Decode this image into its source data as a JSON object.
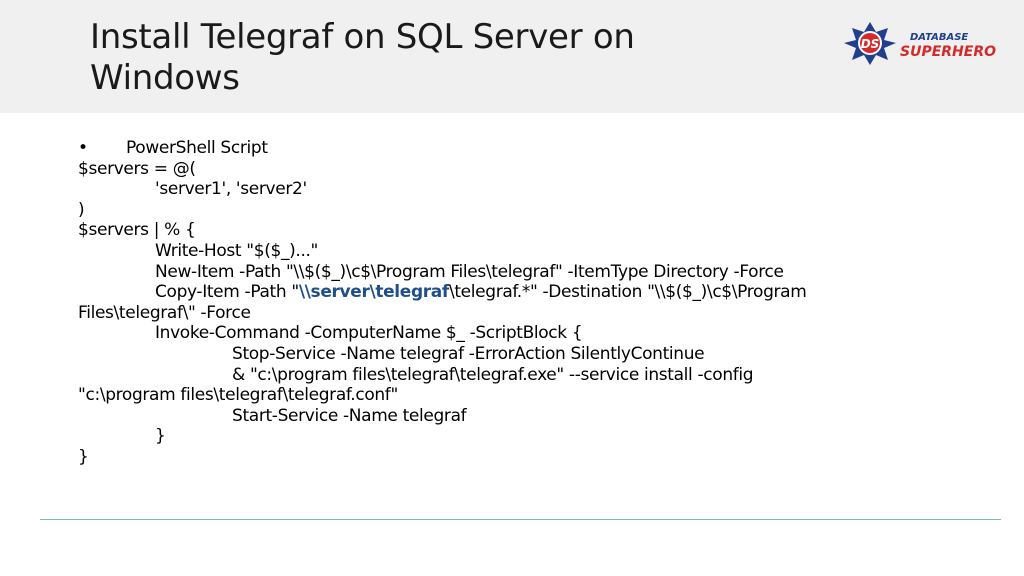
{
  "slide": {
    "title": "Install Telegraf on SQL Server on Windows",
    "logo_top": "DATABASE",
    "logo_bottom": "SUPERHERO",
    "logo_badge": "DS"
  },
  "content": {
    "bullet": "•",
    "heading": "PowerShell Script",
    "l1": "$servers = @(",
    "l2": "'server1', 'server2'",
    "l3": ")",
    "l4": "$servers | % {",
    "l5": "Write-Host \"$($_)...\"",
    "l6": "New-Item -Path \"\\\\$($_)\\c$\\Program Files\\telegraf\" -ItemType Directory -Force",
    "l7_a": "Copy-Item -Path \"",
    "l7_b": "\\\\server\\telegraf",
    "l7_c": "\\telegraf.*\" -Destination \"\\\\$($_)\\c$\\Program",
    "l8": "Files\\telegraf\\\" -Force",
    "l9": "Invoke-Command -ComputerName $_ -ScriptBlock {",
    "l10": "Stop-Service -Name telegraf -ErrorAction SilentlyContinue",
    "l11": "& \"c:\\program files\\telegraf\\telegraf.exe\" --service install -config",
    "l12": "\"c:\\program files\\telegraf\\telegraf.conf\"",
    "l13": "Start-Service -Name telegraf",
    "l14": "}",
    "l15": "}"
  },
  "colors": {
    "title_band": "#f0f0f0",
    "highlight": "#1f4e8c",
    "divider": "#7fb3d1",
    "logo_blue": "#1f3f8f",
    "logo_red": "#d42a2a"
  },
  "icons": [
    "database-superhero-logo"
  ]
}
